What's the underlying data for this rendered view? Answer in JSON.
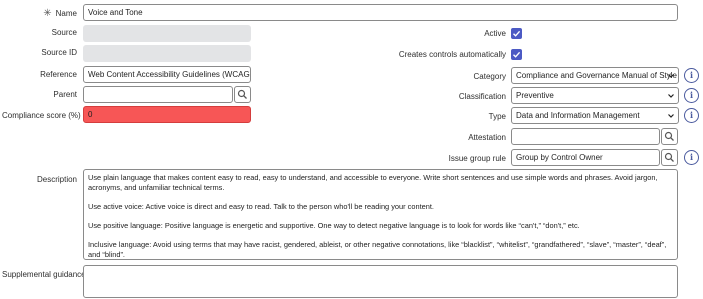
{
  "form": {
    "name": {
      "label": "Name",
      "required_marker": "✳",
      "value": "Voice and Tone"
    },
    "source": {
      "label": "Source",
      "value": ""
    },
    "source_id": {
      "label": "Source ID",
      "value": ""
    },
    "reference": {
      "label": "Reference",
      "value": "Web Content Accessibility Guidelines (WCAG)"
    },
    "parent": {
      "label": "Parent",
      "value": ""
    },
    "compliance_score": {
      "label": "Compliance score (%)",
      "value": "0"
    },
    "active": {
      "label": "Active",
      "checked": true
    },
    "creates_controls": {
      "label": "Creates controls automatically",
      "checked": true
    },
    "category": {
      "label": "Category",
      "value": "Compliance and Governance Manual of Style"
    },
    "classification": {
      "label": "Classification",
      "value": "Preventive"
    },
    "type": {
      "label": "Type",
      "value": "Data and Information Management"
    },
    "attestation": {
      "label": "Attestation",
      "value": ""
    },
    "issue_group_rule": {
      "label": "Issue group rule",
      "value": "Group by Control Owner"
    },
    "description": {
      "label": "Description",
      "paragraphs": [
        "Use plain language that makes content easy to read, easy to understand, and accessible to everyone. Write short sentences and use simple words and phrases. Avoid jargon, acronyms, and unfamiliar technical terms.",
        "Use active voice: Active voice is direct and easy to read. Talk to the person who'll be reading your content.",
        "Use positive language: Positive language is energetic and supportive. One way to detect negative language is to look for words like “can't,” “don't,” etc.",
        "Inclusive language: Avoid using terms that may have racist, gendered, ableist, or other negative connotations, like “blacklist”, “whitelist”, “grandfathered”, “slave”, “master”, “deaf”, and “blind”."
      ]
    },
    "supplemental_guidance": {
      "label": "Supplemental guidance",
      "value": ""
    }
  },
  "colors": {
    "accent": "#4c5ac4",
    "error": "#f75656",
    "readonly": "#e3e4e6"
  },
  "icons": {
    "lookup": "search-icon",
    "info": "info-icon",
    "dropdown": "chevron-down-icon"
  }
}
